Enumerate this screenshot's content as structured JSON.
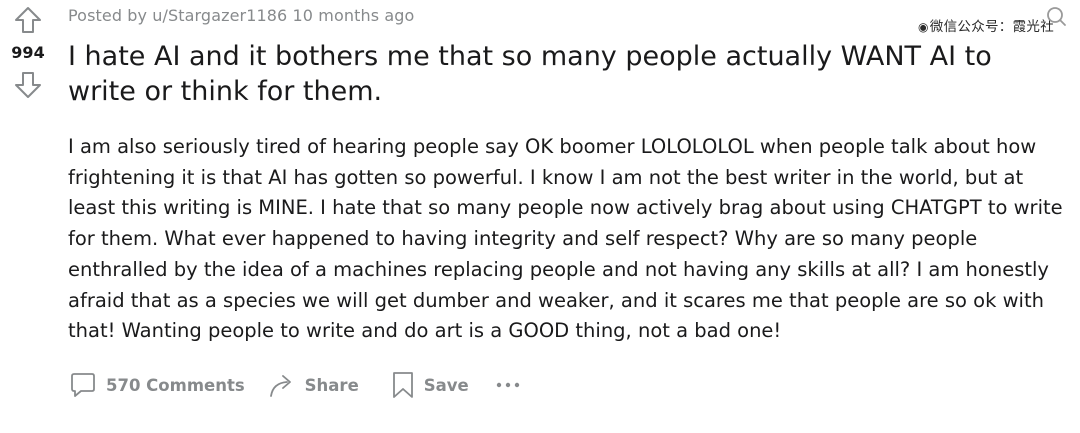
{
  "post": {
    "score": "994",
    "meta": "Posted by u/Stargazer1186 10 months ago",
    "title": "I hate AI and it bothers me that so many people actually WANT AI to write or think for them.",
    "body": "I am also seriously tired of hearing people say OK boomer LOLOLOLOL when people talk about how frightening it is that AI has gotten so powerful. I know I am not the best writer in the world, but at least this writing is MINE. I hate that so many people now actively brag about using CHATGPT to write for them. What ever happened to having integrity and self respect? Why are so many people enthralled by the idea of a machines replacing people and not having any skills at all? I am honestly afraid that as a species we will get dumber and weaker, and it scares me that people are so ok with that! Wanting people to write and do art is a GOOD thing, not a bad one!"
  },
  "actions": {
    "comments": "570 Comments",
    "share": "Share",
    "save": "Save"
  },
  "watermark": {
    "text": "微信公众号：霞光社"
  },
  "icons": {
    "upvote": "arrow-up-outline-icon",
    "downvote": "arrow-down-outline-icon",
    "comments": "speech-bubble-icon",
    "share": "curved-arrow-share-icon",
    "save": "bookmark-icon",
    "more": "three-dots-icon",
    "corner": "search-icon"
  },
  "colors": {
    "text": "#1a1a1b",
    "muted": "#878a8c",
    "background": "#ffffff"
  }
}
